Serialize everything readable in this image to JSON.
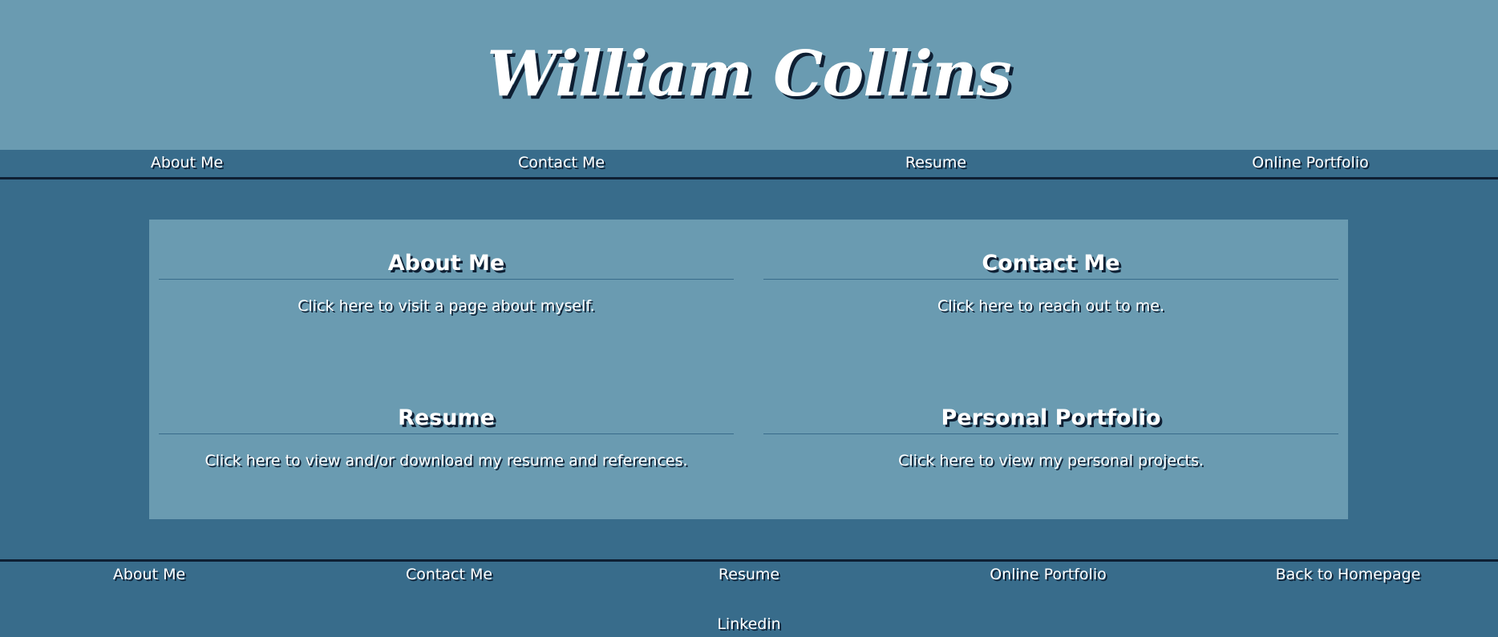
{
  "header": {
    "title": "William Collins"
  },
  "topnav": [
    {
      "label": "About Me"
    },
    {
      "label": "Contact Me"
    },
    {
      "label": "Resume"
    },
    {
      "label": "Online Portfolio"
    }
  ],
  "cards": [
    {
      "heading": "About Me",
      "text": "Click here to visit a page about myself."
    },
    {
      "heading": "Contact Me",
      "text": "Click here to reach out to me."
    },
    {
      "heading": "Resume",
      "text": "Click here to view and/or download my resume and references."
    },
    {
      "heading": "Personal Portfolio",
      "text": "Click here to view my personal projects."
    }
  ],
  "footer": {
    "links": [
      {
        "label": "About Me"
      },
      {
        "label": "Contact Me"
      },
      {
        "label": "Resume"
      },
      {
        "label": "Online Portfolio"
      },
      {
        "label": "Back to Homepage"
      }
    ],
    "social": {
      "label": "Linkedin"
    }
  },
  "colors": {
    "header_bg": "#6a9bb1",
    "page_bg": "#386c8b",
    "border_dark": "#0e1f33",
    "text": "#ffffff"
  }
}
